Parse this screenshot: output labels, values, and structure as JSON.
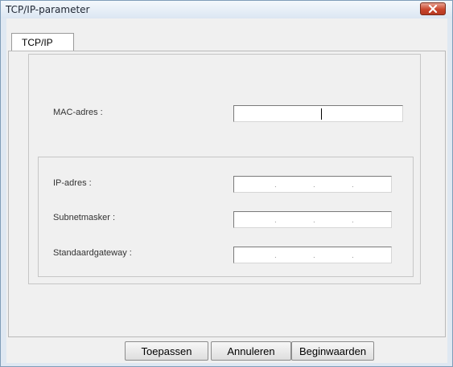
{
  "window": {
    "title": "TCP/IP-parameter"
  },
  "tabs": [
    {
      "label": "TCP/IP"
    }
  ],
  "fields": {
    "mac": {
      "label": "MAC-adres :",
      "value": ""
    },
    "ip": {
      "label": "IP-adres :",
      "value": ""
    },
    "subnet": {
      "label": "Subnetmasker :",
      "value": ""
    },
    "gateway": {
      "label": "Standaardgateway :",
      "value": ""
    }
  },
  "buttons": {
    "apply": "Toepassen",
    "cancel": "Annuleren",
    "defaults": "Beginwaarden"
  },
  "icons": {
    "close": "close-icon"
  },
  "colors": {
    "close_button": "#c9452c",
    "window_frame": "#dfe8f2"
  }
}
